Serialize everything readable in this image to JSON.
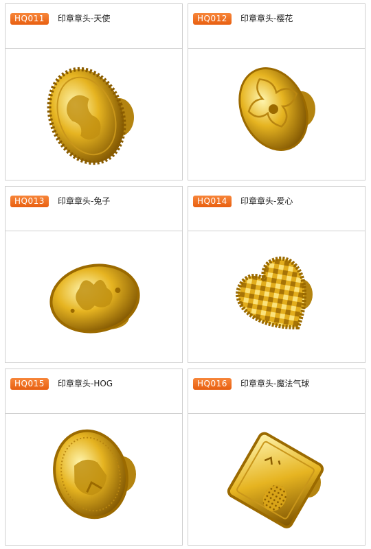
{
  "products": [
    {
      "code": "HQ011",
      "title": "印章章头-天使",
      "icon": "angel-stamp-icon"
    },
    {
      "code": "HQ012",
      "title": "印章章头-樱花",
      "icon": "sakura-stamp-icon"
    },
    {
      "code": "HQ013",
      "title": "印章章头-兔子",
      "icon": "rabbit-stamp-icon"
    },
    {
      "code": "HQ014",
      "title": "印章章头-爱心",
      "icon": "heart-stamp-icon"
    },
    {
      "code": "HQ015",
      "title": "印章章头-HOG",
      "icon": "hog-stamp-icon"
    },
    {
      "code": "HQ016",
      "title": "印章章头-魔法气球",
      "icon": "magic-balloon-stamp-icon"
    }
  ],
  "colors": {
    "accent": "#ee6a1c",
    "gold_light": "#fff3a0",
    "gold_mid": "#e8b820",
    "gold_dark": "#8a5c00"
  }
}
